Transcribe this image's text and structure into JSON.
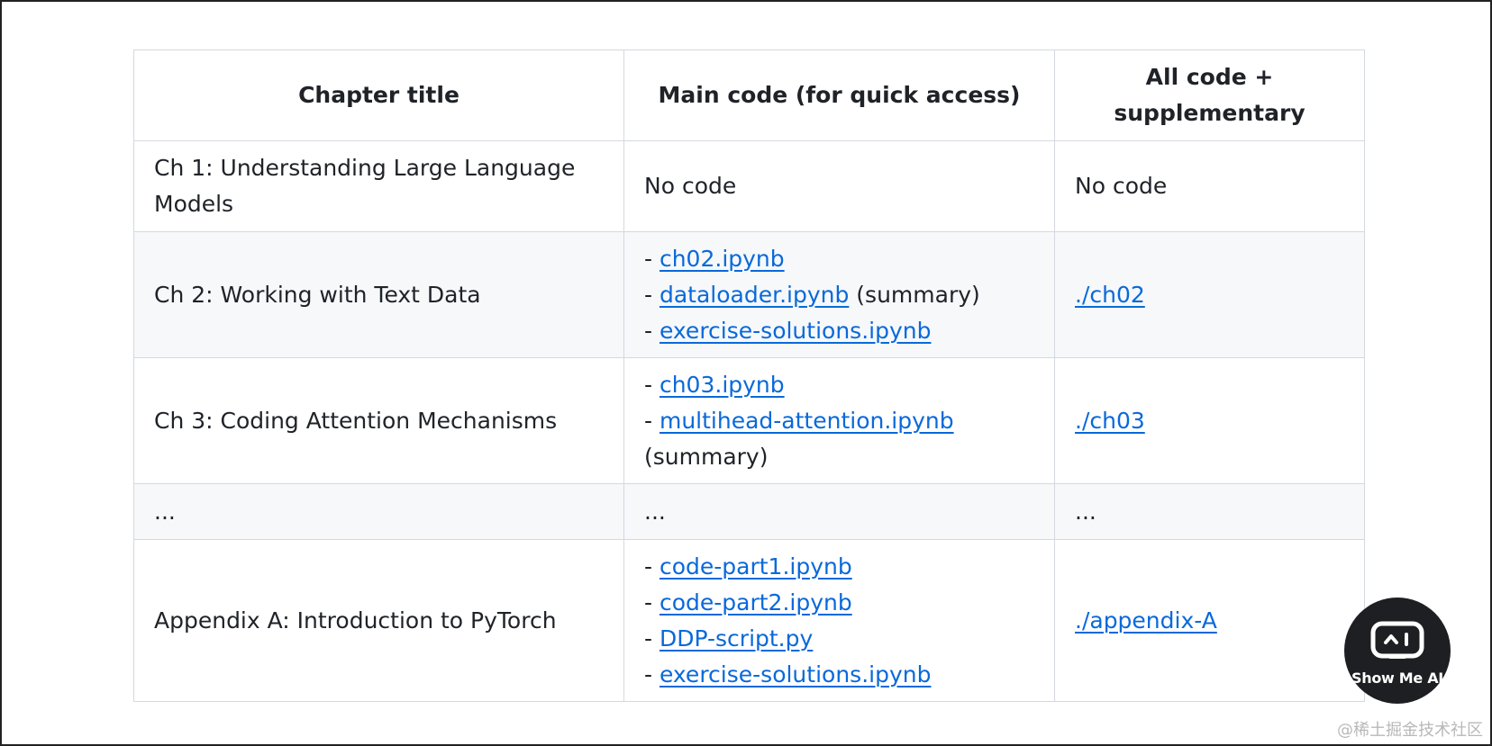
{
  "table": {
    "headers": [
      "Chapter title",
      "Main code (for quick access)",
      "All code + supplementary"
    ],
    "rows": [
      {
        "chapter": "Ch 1: Understanding Large Language Models",
        "main_code_text": "No code",
        "all_code_text": "No code"
      },
      {
        "chapter": "Ch 2: Working with Text Data",
        "main_code": [
          {
            "prefix": "- ",
            "link": "ch02.ipynb",
            "suffix": ""
          },
          {
            "prefix": "- ",
            "link": "dataloader.ipynb",
            "suffix": " (summary)"
          },
          {
            "prefix": "- ",
            "link": "exercise-solutions.ipynb",
            "suffix": ""
          }
        ],
        "all_code_link": "./ch02"
      },
      {
        "chapter": "Ch 3: Coding Attention Mechanisms",
        "main_code": [
          {
            "prefix": "- ",
            "link": "ch03.ipynb",
            "suffix": ""
          },
          {
            "prefix": "- ",
            "link": "multihead-attention.ipynb",
            "suffix": ""
          }
        ],
        "main_code_trailing": "(summary)",
        "all_code_link": "./ch03"
      },
      {
        "chapter": "...",
        "main_code_text": "...",
        "all_code_text": "..."
      },
      {
        "chapter": "Appendix A: Introduction to PyTorch",
        "main_code": [
          {
            "prefix": "- ",
            "link": "code-part1.ipynb",
            "suffix": ""
          },
          {
            "prefix": "- ",
            "link": "code-part2.ipynb",
            "suffix": ""
          },
          {
            "prefix": "- ",
            "link": "DDP-script.py",
            "suffix": ""
          },
          {
            "prefix": "- ",
            "link": "exercise-solutions.ipynb",
            "suffix": ""
          }
        ],
        "all_code_link": "./appendix-A"
      }
    ]
  },
  "badge": {
    "label": "Show Me AI",
    "icon": "robot-face-icon"
  },
  "watermark": "@稀土掘金技术社区",
  "colors": {
    "link": "#0969da",
    "border": "#d4d9df",
    "row_alt": "#f6f8fa",
    "badge_bg": "#1e1f22"
  }
}
